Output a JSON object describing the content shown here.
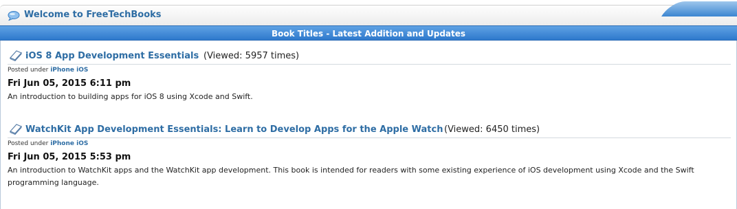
{
  "welcome": {
    "title": "Welcome to FreeTechBooks",
    "icon": "speech-bubble-icon"
  },
  "header": {
    "title": "Book Titles - Latest Addition and Updates"
  },
  "entries": [
    {
      "title": "iOS 8 App Development Essentials",
      "views": "(Viewed: 5957 times)",
      "posted_prefix": "Posted under",
      "category": "iPhone iOS",
      "date": "Fri Jun 05, 2015 6:11 pm",
      "description": "An introduction to building apps for iOS 8 using Xcode and Swift."
    },
    {
      "title": "WatchKit App Development Essentials: Learn to Develop Apps for the Apple Watch",
      "views": "(Viewed: 6450 times)",
      "posted_prefix": "Posted under",
      "category": "iPhone iOS",
      "date": "Fri Jun 05, 2015 5:53 pm",
      "description": "An introduction to WatchKit apps and the WatchKit app development. This book is intended for readers with some existing experience of iOS development using Xcode and the Swift programming language."
    }
  ],
  "colors": {
    "link": "#2e6da4",
    "header_bg": "#3a85d6"
  }
}
